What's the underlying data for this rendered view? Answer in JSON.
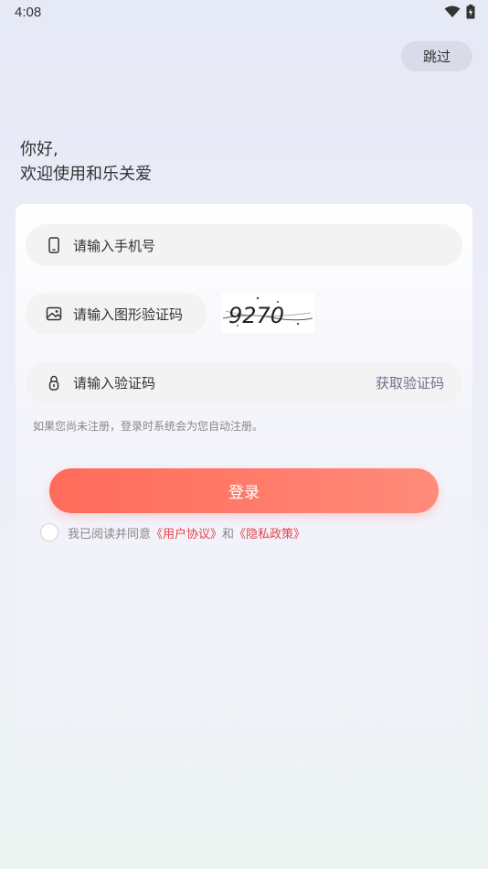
{
  "status": {
    "time": "4:08",
    "wifi_icon": "wifi-icon",
    "battery_icon": "battery-icon"
  },
  "header": {
    "skip_label": "跳过"
  },
  "greeting": {
    "line1": "你好,",
    "line2": "欢迎使用和乐关爱"
  },
  "form": {
    "phone_placeholder": "请输入手机号",
    "captcha_placeholder": "请输入图形验证码",
    "captcha_text": "9270",
    "code_placeholder": "请输入验证码",
    "get_code_label": "获取验证码",
    "hint": "如果您尚未注册，登录时系统会为您自动注册。"
  },
  "login_label": "登录",
  "agreement": {
    "prefix": "我已阅读并同意",
    "user_agreement": "《用户协议》",
    "and": "和",
    "privacy_policy": "《隐私政策》",
    "checked": false
  },
  "colors": {
    "accent": "#ff6b5b",
    "link": "#e5444a"
  }
}
